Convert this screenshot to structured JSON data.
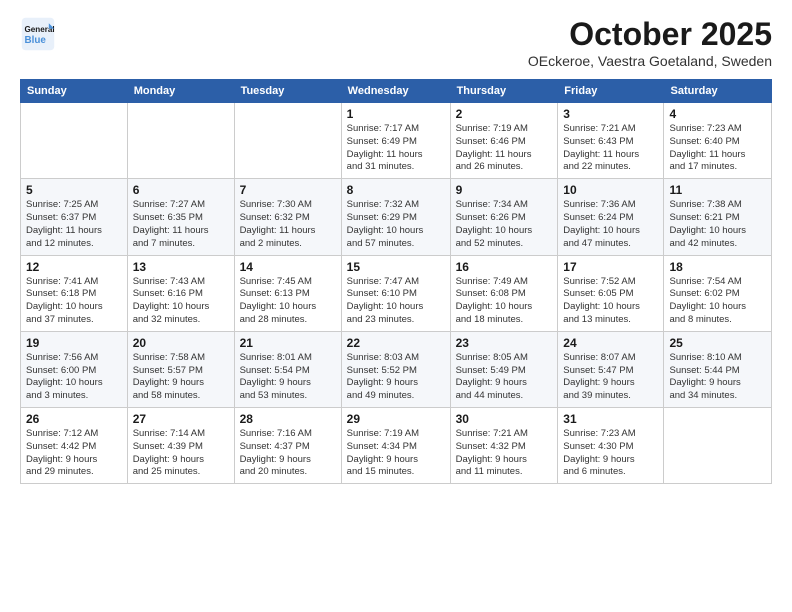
{
  "logo": {
    "line1": "General",
    "line2": "Blue"
  },
  "header": {
    "title": "October 2025",
    "location": "OEckeroe, Vaestra Goetaland, Sweden"
  },
  "days_of_week": [
    "Sunday",
    "Monday",
    "Tuesday",
    "Wednesday",
    "Thursday",
    "Friday",
    "Saturday"
  ],
  "weeks": [
    [
      {
        "day": "",
        "info": ""
      },
      {
        "day": "",
        "info": ""
      },
      {
        "day": "",
        "info": ""
      },
      {
        "day": "1",
        "info": "Sunrise: 7:17 AM\nSunset: 6:49 PM\nDaylight: 11 hours\nand 31 minutes."
      },
      {
        "day": "2",
        "info": "Sunrise: 7:19 AM\nSunset: 6:46 PM\nDaylight: 11 hours\nand 26 minutes."
      },
      {
        "day": "3",
        "info": "Sunrise: 7:21 AM\nSunset: 6:43 PM\nDaylight: 11 hours\nand 22 minutes."
      },
      {
        "day": "4",
        "info": "Sunrise: 7:23 AM\nSunset: 6:40 PM\nDaylight: 11 hours\nand 17 minutes."
      }
    ],
    [
      {
        "day": "5",
        "info": "Sunrise: 7:25 AM\nSunset: 6:37 PM\nDaylight: 11 hours\nand 12 minutes."
      },
      {
        "day": "6",
        "info": "Sunrise: 7:27 AM\nSunset: 6:35 PM\nDaylight: 11 hours\nand 7 minutes."
      },
      {
        "day": "7",
        "info": "Sunrise: 7:30 AM\nSunset: 6:32 PM\nDaylight: 11 hours\nand 2 minutes."
      },
      {
        "day": "8",
        "info": "Sunrise: 7:32 AM\nSunset: 6:29 PM\nDaylight: 10 hours\nand 57 minutes."
      },
      {
        "day": "9",
        "info": "Sunrise: 7:34 AM\nSunset: 6:26 PM\nDaylight: 10 hours\nand 52 minutes."
      },
      {
        "day": "10",
        "info": "Sunrise: 7:36 AM\nSunset: 6:24 PM\nDaylight: 10 hours\nand 47 minutes."
      },
      {
        "day": "11",
        "info": "Sunrise: 7:38 AM\nSunset: 6:21 PM\nDaylight: 10 hours\nand 42 minutes."
      }
    ],
    [
      {
        "day": "12",
        "info": "Sunrise: 7:41 AM\nSunset: 6:18 PM\nDaylight: 10 hours\nand 37 minutes."
      },
      {
        "day": "13",
        "info": "Sunrise: 7:43 AM\nSunset: 6:16 PM\nDaylight: 10 hours\nand 32 minutes."
      },
      {
        "day": "14",
        "info": "Sunrise: 7:45 AM\nSunset: 6:13 PM\nDaylight: 10 hours\nand 28 minutes."
      },
      {
        "day": "15",
        "info": "Sunrise: 7:47 AM\nSunset: 6:10 PM\nDaylight: 10 hours\nand 23 minutes."
      },
      {
        "day": "16",
        "info": "Sunrise: 7:49 AM\nSunset: 6:08 PM\nDaylight: 10 hours\nand 18 minutes."
      },
      {
        "day": "17",
        "info": "Sunrise: 7:52 AM\nSunset: 6:05 PM\nDaylight: 10 hours\nand 13 minutes."
      },
      {
        "day": "18",
        "info": "Sunrise: 7:54 AM\nSunset: 6:02 PM\nDaylight: 10 hours\nand 8 minutes."
      }
    ],
    [
      {
        "day": "19",
        "info": "Sunrise: 7:56 AM\nSunset: 6:00 PM\nDaylight: 10 hours\nand 3 minutes."
      },
      {
        "day": "20",
        "info": "Sunrise: 7:58 AM\nSunset: 5:57 PM\nDaylight: 9 hours\nand 58 minutes."
      },
      {
        "day": "21",
        "info": "Sunrise: 8:01 AM\nSunset: 5:54 PM\nDaylight: 9 hours\nand 53 minutes."
      },
      {
        "day": "22",
        "info": "Sunrise: 8:03 AM\nSunset: 5:52 PM\nDaylight: 9 hours\nand 49 minutes."
      },
      {
        "day": "23",
        "info": "Sunrise: 8:05 AM\nSunset: 5:49 PM\nDaylight: 9 hours\nand 44 minutes."
      },
      {
        "day": "24",
        "info": "Sunrise: 8:07 AM\nSunset: 5:47 PM\nDaylight: 9 hours\nand 39 minutes."
      },
      {
        "day": "25",
        "info": "Sunrise: 8:10 AM\nSunset: 5:44 PM\nDaylight: 9 hours\nand 34 minutes."
      }
    ],
    [
      {
        "day": "26",
        "info": "Sunrise: 7:12 AM\nSunset: 4:42 PM\nDaylight: 9 hours\nand 29 minutes."
      },
      {
        "day": "27",
        "info": "Sunrise: 7:14 AM\nSunset: 4:39 PM\nDaylight: 9 hours\nand 25 minutes."
      },
      {
        "day": "28",
        "info": "Sunrise: 7:16 AM\nSunset: 4:37 PM\nDaylight: 9 hours\nand 20 minutes."
      },
      {
        "day": "29",
        "info": "Sunrise: 7:19 AM\nSunset: 4:34 PM\nDaylight: 9 hours\nand 15 minutes."
      },
      {
        "day": "30",
        "info": "Sunrise: 7:21 AM\nSunset: 4:32 PM\nDaylight: 9 hours\nand 11 minutes."
      },
      {
        "day": "31",
        "info": "Sunrise: 7:23 AM\nSunset: 4:30 PM\nDaylight: 9 hours\nand 6 minutes."
      },
      {
        "day": "",
        "info": ""
      }
    ]
  ]
}
